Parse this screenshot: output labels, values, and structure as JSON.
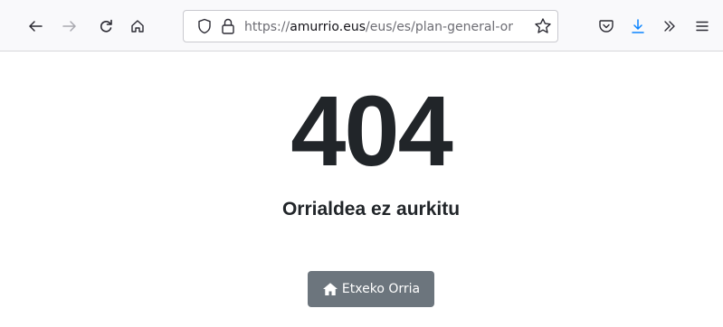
{
  "browser": {
    "url_prefix": "https://",
    "url_host": "amurrio.eus",
    "url_path": "/eus/es/plan-general-or",
    "icons": {
      "back": "arrow-left-icon",
      "forward": "arrow-right-icon",
      "reload": "reload-icon",
      "home": "home-icon",
      "tracking_protection": "shield-icon",
      "site_security": "lock-icon",
      "bookmark": "star-icon",
      "pocket": "pocket-icon",
      "downloads": "download-icon",
      "overflow": "chevron-double-right-icon",
      "menu": "hamburger-menu-icon"
    },
    "colors": {
      "download_accent": "#0a84ff",
      "toolbar_bg": "#f9f9fb"
    }
  },
  "page": {
    "error_code": "404",
    "message": "Orrialdea ez aurkitu",
    "home_button_label": "Etxeko Orria",
    "home_button_icon": "home-icon",
    "colors": {
      "text": "#212529",
      "button_bg": "#6c757d",
      "button_text": "#ffffff"
    }
  }
}
